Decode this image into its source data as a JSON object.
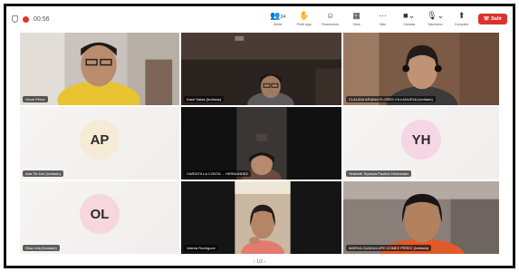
{
  "window": {
    "time": "00:56"
  },
  "toolbar": {
    "items": [
      {
        "icon": "people-icon",
        "badge": "24",
        "label": "Gente"
      },
      {
        "icon": "raise-hand-icon",
        "label": "Pedir algo"
      },
      {
        "icon": "reaction-icon",
        "label": "Reacciones"
      },
      {
        "icon": "view-icon",
        "label": "Vista"
      },
      {
        "icon": "more-icon",
        "label": "Más"
      },
      {
        "icon": "camera-icon",
        "label": "Cámara"
      },
      {
        "icon": "mic-icon",
        "label": "Micrófono"
      },
      {
        "icon": "share-icon",
        "label": "Compartir"
      }
    ],
    "leave_label": "Salir"
  },
  "participants": [
    {
      "name": "Omar Pérez",
      "type": "video"
    },
    {
      "name": "Karel Salas (Invitado)",
      "type": "video"
    },
    {
      "name": "CLAUDIA ARIANA FLORES VILLANUEVA (Invitado)",
      "type": "video"
    },
    {
      "name": "Ada Tie Dar (Invitado)",
      "type": "avatar",
      "initials": "AP",
      "color": "#f6ecd5"
    },
    {
      "name": "CARDITA LA CONTA ... HERNANDEZ",
      "type": "video"
    },
    {
      "name": "Yesibeth Tepesca Paulina Hernandez",
      "type": "avatar",
      "initials": "YH",
      "color": "#f5d6e4"
    },
    {
      "name": "Olsa Lela (Invitado)",
      "type": "avatar",
      "initials": "OL",
      "color": "#f6d6df"
    },
    {
      "name": "Valeria Rodríguez",
      "type": "video"
    },
    {
      "name": "MARGA GUADALUPE GÓMEZ PÉREZ (Invitado)",
      "type": "video"
    }
  ],
  "pager": {
    "text": "1/2"
  }
}
